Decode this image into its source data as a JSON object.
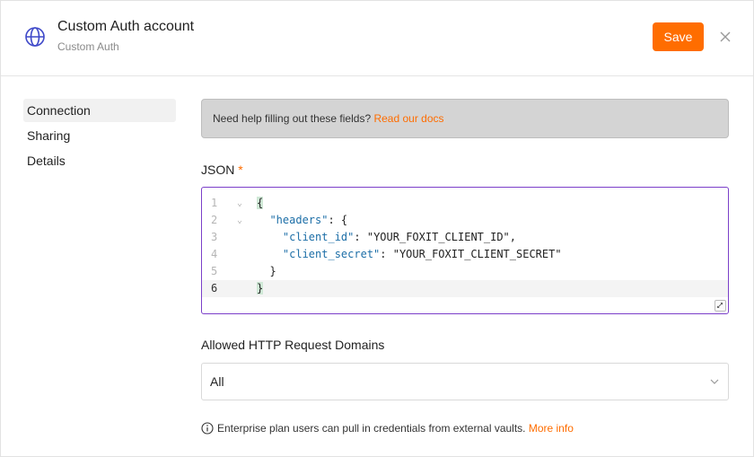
{
  "header": {
    "title": "Custom Auth account",
    "subtitle": "Custom Auth",
    "save_label": "Save",
    "close_icon": "close-icon",
    "app_icon": "globe-icon"
  },
  "sidebar": {
    "items": [
      {
        "label": "Connection",
        "active": true
      },
      {
        "label": "Sharing",
        "active": false
      },
      {
        "label": "Details",
        "active": false
      }
    ]
  },
  "help": {
    "text": "Need help filling out these fields?",
    "link": "Read our docs"
  },
  "json_field": {
    "label": "JSON",
    "required_marker": "*",
    "line_numbers": [
      "1",
      "2",
      "3",
      "4",
      "5",
      "6"
    ],
    "lines": [
      {
        "open_brace": "{"
      },
      {
        "indent": "  ",
        "key": "\"headers\"",
        "rest": ": {"
      },
      {
        "indent": "    ",
        "key": "\"client_id\"",
        "sep": ": ",
        "value": "\"YOUR_FOXIT_CLIENT_ID\"",
        "rest": ","
      },
      {
        "indent": "    ",
        "key": "\"client_secret\"",
        "sep": ": ",
        "value": "\"YOUR_FOXIT_CLIENT_SECRET\""
      },
      {
        "indent": "  ",
        "rest": "}"
      },
      {
        "close_brace": "}"
      }
    ]
  },
  "domains": {
    "label": "Allowed HTTP Request Domains",
    "selected": "All"
  },
  "footer_note": {
    "text": "Enterprise plan users can pull in credentials from external vaults.",
    "link": "More info"
  },
  "colors": {
    "accent": "#ff6d00",
    "editor_focus": "#7b3fc9",
    "json_key": "#1c6ea7"
  }
}
